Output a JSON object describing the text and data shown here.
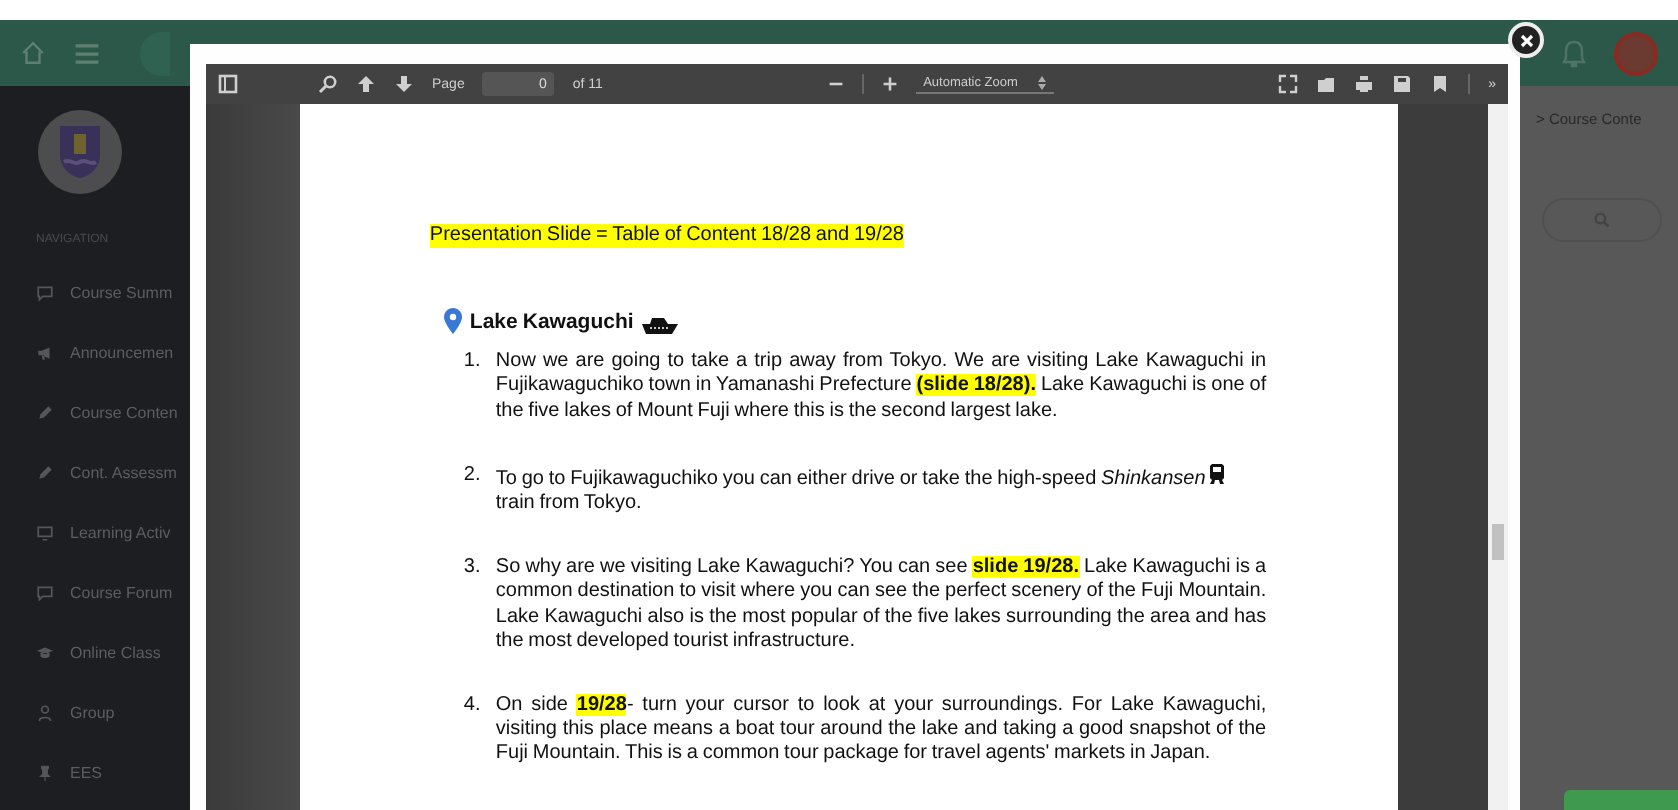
{
  "header": {
    "breadcrumb": "> Course Conte"
  },
  "sidebar": {
    "section": "NAVIGATION",
    "items": [
      {
        "label": "Course Summ"
      },
      {
        "label": "Announcemen"
      },
      {
        "label": "Course Conten"
      },
      {
        "label": "Cont. Assessm"
      },
      {
        "label": "Learning Activ"
      },
      {
        "label": "Course Forum"
      },
      {
        "label": "Online Class"
      },
      {
        "label": "Group"
      },
      {
        "label": "EES"
      }
    ]
  },
  "viewer": {
    "toolbar": {
      "page_label": "Page",
      "page_value": "0",
      "page_count": "of 11",
      "zoom": "Automatic Zoom",
      "overflow": "»"
    },
    "document": {
      "title": "Presentation Slide = Table of Content 18/28 and 19/28",
      "heading": "Lake Kawaguchi",
      "items": [
        {
          "number": "1.",
          "text": "Now we are going to take a trip away from Tokyo. We are visiting Lake Kawaguchi in Fujikawaguchiko town in Yamanashi Prefecture **(slide 18/28).** Lake Kawaguchi is one of the five lakes of Mount Fuji where this is the second largest lake.",
          "kind": "plain"
        },
        {
          "number": "2.",
          "text": "To go to Fujikawaguchiko you can either drive or take the high-speed *Shinkansen*",
          "kind": "train",
          "text_after": "train from Tokyo."
        },
        {
          "number": "3.",
          "text": "So why are we visiting Lake Kawaguchi? You can see **slide 19/28.** Lake Kawaguchi is a common destination to visit where you can see the perfect scenery of the Fuji Mountain. Lake Kawaguchi also is the most popular of the five lakes surrounding the area and has the most developed tourist infrastructure.",
          "kind": "plain"
        },
        {
          "number": "4.",
          "text": "On side **19/28**- turn your cursor to look at your surroundings.  For Lake Kawaguchi, visiting this place means a boat tour around the lake and taking a good snapshot of the Fuji Mountain. This is a common tour package for travel agents' markets in Japan.",
          "kind": "plain"
        }
      ]
    }
  }
}
